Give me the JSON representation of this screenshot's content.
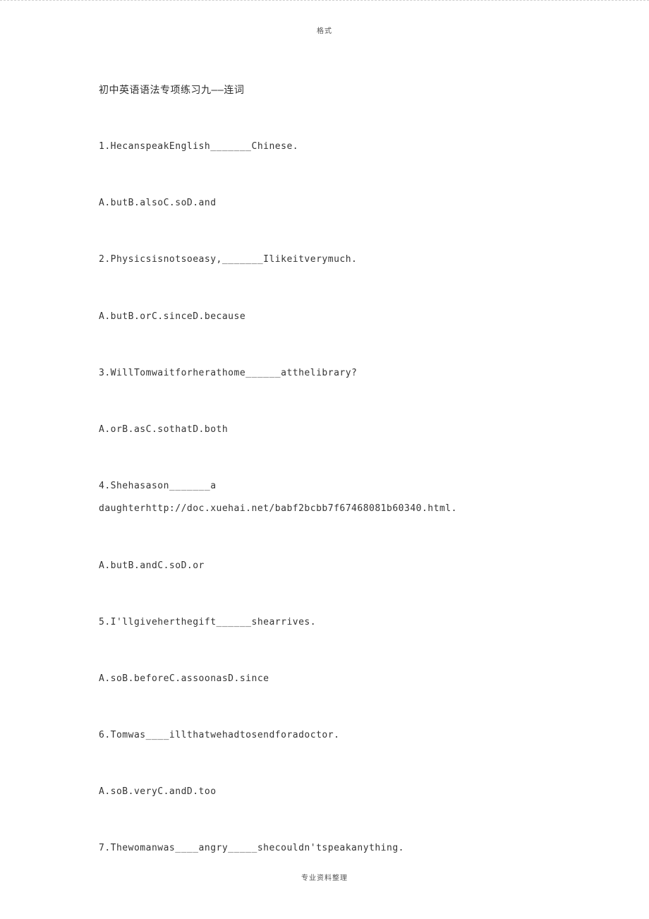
{
  "header": {
    "text": "格式"
  },
  "title": "初中英语语法专项练习九——连词",
  "items": [
    {
      "q": "1.HecanspeakEnglish_______Chinese.",
      "a": "A.butB.alsoC.soD.and"
    },
    {
      "q": "2.Physicsisnotsoeasy,_______Ilikeitverymuch.",
      "a": "A.butB.orC.sinceD.because"
    },
    {
      "q": "3.WillTomwaitforherathome______atthelibrary?",
      "a": "A.orB.asC.sothatD.both"
    },
    {
      "q": "4.Shehasason_______a",
      "q2": "daughterhttp://doc.xuehai.net/babf2bcbb7f67468081b60340.html.",
      "a": "A.butB.andC.soD.or"
    },
    {
      "q": "5.I'llgiveherthegift______shearrives.",
      "a": "A.soB.beforeC.assoonasD.since"
    },
    {
      "q": "6.Tomwas____illthatwehadtosendforadoctor.",
      "a": "A.soB.veryC.andD.too"
    },
    {
      "q": "7.Thewomanwas____angry_____shecouldn'tspeakanything."
    }
  ],
  "footer": {
    "text": "专业资料整理"
  }
}
